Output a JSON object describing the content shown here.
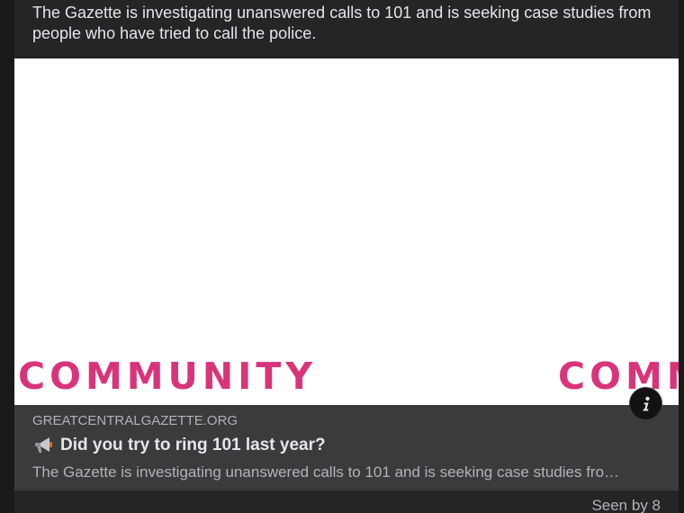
{
  "post": {
    "text": "The Gazette is investigating unanswered calls to 101 and is seeking case studies from people who have tried to call the police."
  },
  "link_preview": {
    "image_banner_text": "COMMUNITY",
    "domain": "GREATCENTRALGAZETTE.ORG",
    "title": "Did you try to ring 101 last year?",
    "title_icon": "megaphone-icon",
    "description": "The Gazette is investigating unanswered calls to 101 and is seeking case studies fro…",
    "info_icon": "info-icon"
  },
  "footer": {
    "seen_by": "Seen by 8"
  },
  "colors": {
    "background": "#18191a",
    "card": "#242526",
    "preview_meta": "#3a3b3c",
    "banner_text": "#d9347a",
    "primary_text": "#e4e6eb",
    "secondary_text": "#b0b3b8"
  }
}
